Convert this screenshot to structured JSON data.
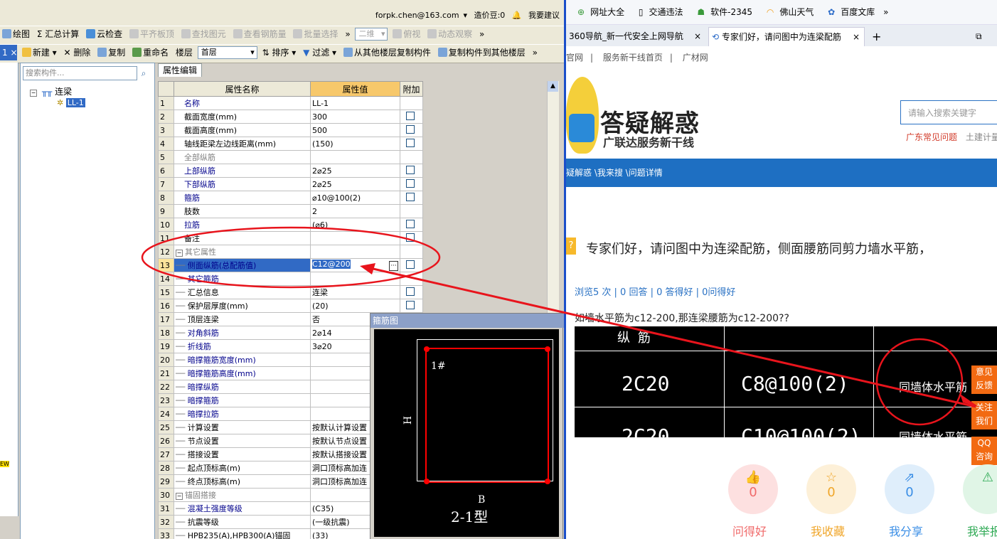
{
  "app": {
    "top_info": {
      "email": "forpk.chen@163.com",
      "cost": "造价豆:0",
      "suggest": "我要建议"
    },
    "toolbar1": [
      "绘图",
      "汇总计算",
      "云检查",
      "平齐板顶",
      "查找图元",
      "查看钢筋量",
      "批量选择",
      "二维",
      "俯视",
      "动态观察"
    ],
    "toolbar2": [
      "新建",
      "删除",
      "复制",
      "重命名",
      "楼层",
      "首层",
      "排序",
      "过滤",
      "从其他楼层复制构件",
      "复制构件到其他楼层"
    ],
    "search_placeholder": "搜索构件...",
    "tree_root": "连梁",
    "tree_child": "LL-1",
    "prop_tab": "属性编辑",
    "grid_headers": [
      "属性名称",
      "属性值",
      "附加"
    ],
    "rows": [
      {
        "n": "1",
        "name": "名称",
        "val": "LL-1"
      },
      {
        "n": "2",
        "name": "截面宽度(mm)",
        "val": "300"
      },
      {
        "n": "3",
        "name": "截面高度(mm)",
        "val": "500"
      },
      {
        "n": "4",
        "name": "轴线距梁左边线距离(mm)",
        "val": "(150)"
      },
      {
        "n": "5",
        "name": "全部纵筋",
        "val": ""
      },
      {
        "n": "6",
        "name": "上部纵筋",
        "val": "2⌀25"
      },
      {
        "n": "7",
        "name": "下部纵筋",
        "val": "2⌀25"
      },
      {
        "n": "8",
        "name": "箍筋",
        "val": "⌀10@100(2)"
      },
      {
        "n": "9",
        "name": "肢数",
        "val": "2"
      },
      {
        "n": "10",
        "name": "拉筋",
        "val": "(⌀6)"
      },
      {
        "n": "11",
        "name": "备注",
        "val": ""
      },
      {
        "n": "12",
        "name": "其它属性",
        "val": ""
      },
      {
        "n": "13",
        "name": "侧面纵筋(总配筋值)",
        "val": "C12@200"
      },
      {
        "n": "14",
        "name": "其它箍筋",
        "val": ""
      },
      {
        "n": "15",
        "name": "汇总信息",
        "val": "连梁"
      },
      {
        "n": "16",
        "name": "保护层厚度(mm)",
        "val": "(20)"
      },
      {
        "n": "17",
        "name": "顶层连梁",
        "val": "否"
      },
      {
        "n": "18",
        "name": "对角斜筋",
        "val": "2⌀14"
      },
      {
        "n": "19",
        "name": "折线筋",
        "val": "3⌀20"
      },
      {
        "n": "20",
        "name": "暗撑箍筋宽度(mm)",
        "val": ""
      },
      {
        "n": "21",
        "name": "暗撑箍筋高度(mm)",
        "val": ""
      },
      {
        "n": "22",
        "name": "暗撑纵筋",
        "val": ""
      },
      {
        "n": "23",
        "name": "暗撑箍筋",
        "val": ""
      },
      {
        "n": "24",
        "name": "暗撑拉筋",
        "val": ""
      },
      {
        "n": "25",
        "name": "计算设置",
        "val": "按默认计算设置"
      },
      {
        "n": "26",
        "name": "节点设置",
        "val": "按默认节点设置"
      },
      {
        "n": "27",
        "name": "搭接设置",
        "val": "按默认搭接设置"
      },
      {
        "n": "28",
        "name": "起点顶标高(m)",
        "val": "洞口顶标高加连"
      },
      {
        "n": "29",
        "name": "终点顶标高(m)",
        "val": "洞口顶标高加连"
      },
      {
        "n": "30",
        "name": "锚固搭接",
        "val": ""
      },
      {
        "n": "31",
        "name": "混凝土强度等级",
        "val": "(C35)"
      },
      {
        "n": "32",
        "name": "抗震等级",
        "val": "(一级抗震)"
      },
      {
        "n": "33",
        "name": "HPB235(A),HPB300(A)锚固",
        "val": "(33)"
      }
    ],
    "dialog": {
      "title": "箍筋图",
      "label_1": "1#",
      "label_h": "H",
      "label_b": "B",
      "type": "2-1型"
    },
    "left_tag": "EW"
  },
  "browser": {
    "favorites": [
      "网址大全",
      "交通违法",
      "软件-2345",
      "佛山天气",
      "百度文库"
    ],
    "tabs": [
      "360导航_新一代安全上网导航",
      "专家们好，请问图中为连梁配筋"
    ],
    "nav": [
      "官网",
      "服务新干线首页",
      "广材网"
    ],
    "site_title": "答疑解惑",
    "site_sub": "广联达服务新干线",
    "search_placeholder": "请输入搜索关键字",
    "hot_links": [
      "广东常见问题",
      "土建计量"
    ],
    "breadcrumb": "疑解惑 \\我来搜 \\问题详情",
    "question_title": "专家们好，请问图中为连梁配筋，侧面腰筋同剪力墙水平筋，",
    "stats": "浏览5 次 | 0 回答 | 0 答得好 | 0问得好",
    "question_text": "如墙水平筋为c12-200,那连梁腰筋为c12-200??",
    "img_cells": {
      "top_left": "纵 筋",
      "r1c1": "2C20",
      "r1c2": "C8@100(2)",
      "r1c3": "同墙体水平筋",
      "r2c1": "2C20",
      "r2c2": "C10@100(2)",
      "r2c3": "同墙体水平筋"
    },
    "side": {
      "feedback": [
        "意见",
        "反馈"
      ],
      "follow": [
        "关注",
        "我们"
      ],
      "qq": [
        "QQ",
        "咨询"
      ]
    },
    "actions": [
      {
        "label": "问得好",
        "count": "0",
        "color": "#f06a6a"
      },
      {
        "label": "我收藏",
        "count": "0",
        "color": "#f0a62a"
      },
      {
        "label": "我分享",
        "count": "0",
        "color": "#3a8ee6"
      },
      {
        "label": "我举报",
        "count": "",
        "color": "#2faa55"
      }
    ]
  }
}
